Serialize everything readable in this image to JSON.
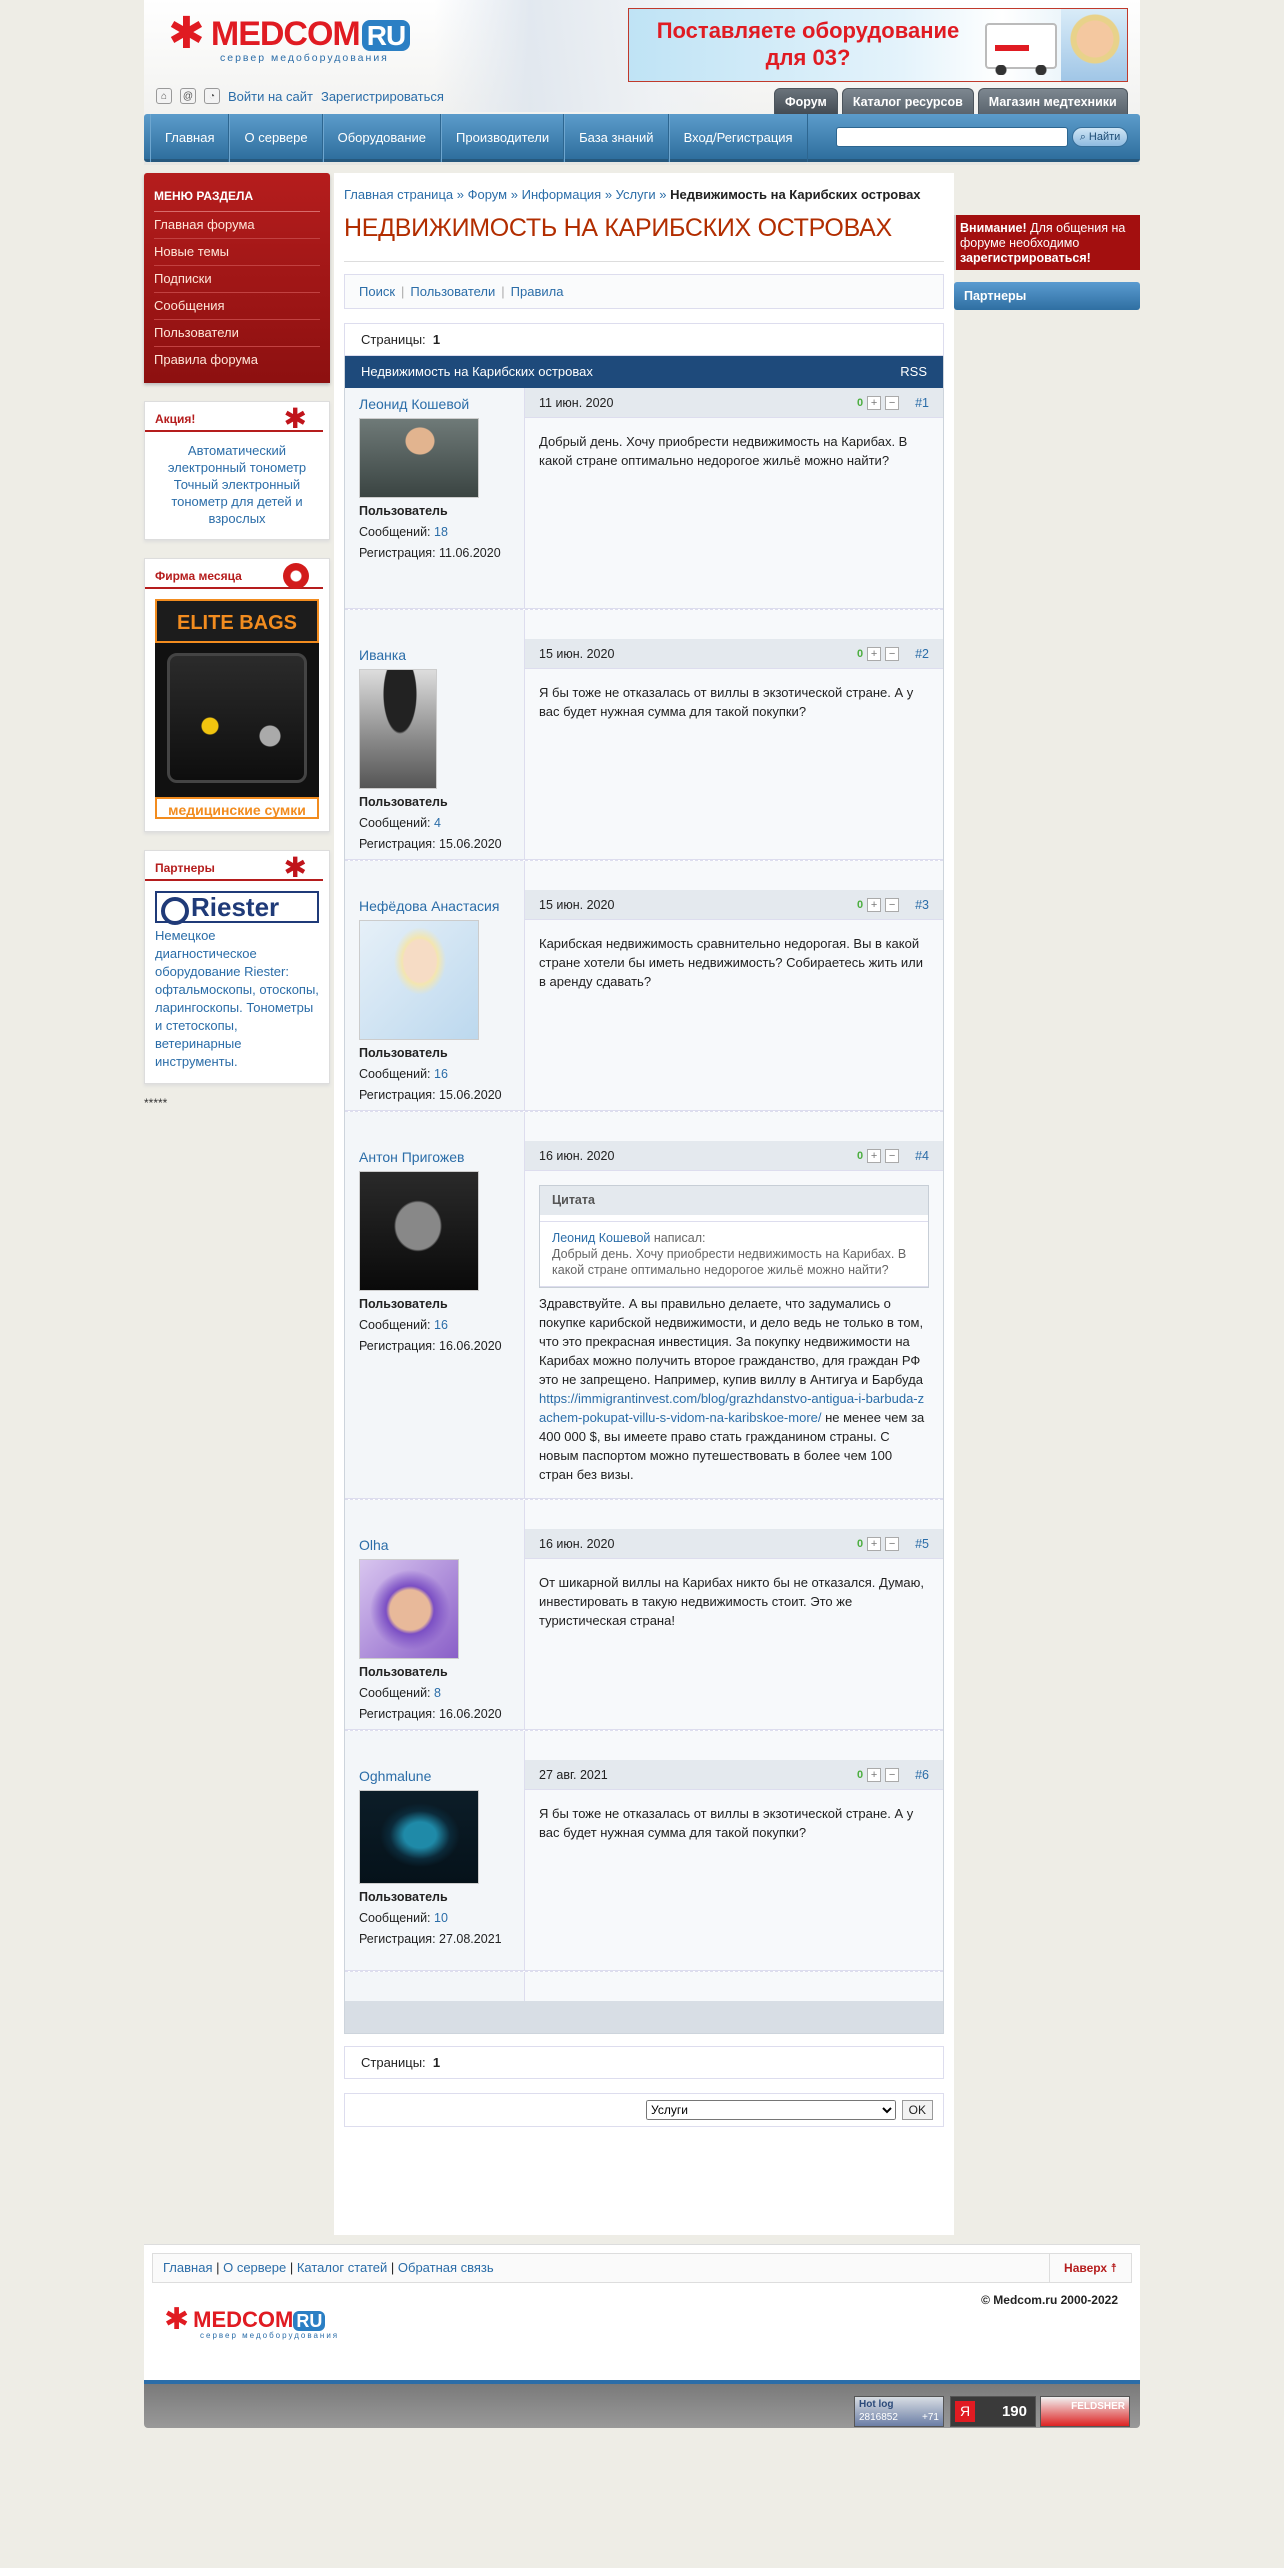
{
  "header": {
    "logo_name": "MEDCOM",
    "logo_ru": "RU",
    "logo_tagline": "сервер медоборудования",
    "login_link": "Войти на сайт",
    "register_link": "Зарегистрироваться",
    "banner_text": "Поставляете оборудование для 03?",
    "tabs": [
      "Форум",
      "Каталог ресурсов",
      "Магазин медтехники"
    ]
  },
  "nav": {
    "items": [
      "Главная",
      "О сервере",
      "Оборудование",
      "Производители",
      "База знаний",
      "Вход/Регистрация"
    ],
    "search_placeholder": "",
    "search_button": "Найти"
  },
  "sidebar": {
    "menu_title": "МЕНЮ РАЗДЕЛА",
    "menu_items": [
      "Главная форума",
      "Новые темы",
      "Подписки",
      "Сообщения",
      "Пользователи",
      "Правила форума"
    ],
    "promo_title": "Акция!",
    "promo_product": "Автоматический электронный тонометр Точный электронный тонометр для детей и взрослых",
    "firm_title": "Фирма месяца",
    "firm_banner_top": "ELITE BAGS",
    "firm_banner_bottom": "медицинские сумки",
    "partners_title": "Партнеры",
    "partner_logo": "Riester",
    "partner_text": "Немецкое диагностическое оборудование Riester: офтальмоскопы, отоскопы, ларингоскопы. Тонометры и стетоскопы, ветеринарные инструменты.",
    "stars": "*****"
  },
  "main": {
    "breadcrumb": [
      "Главная страница",
      "Форум",
      "Информация",
      "Услуги"
    ],
    "breadcrumb_sep": "»",
    "breadcrumb_current": "Недвижимость на Карибских островах",
    "title": "НЕДВИЖИМОСТЬ НА КАРИБСКИХ ОСТРОВАХ",
    "subnav": [
      "Поиск",
      "Пользователи",
      "Правила"
    ],
    "pages_label": "Страницы:",
    "pages_value": "1",
    "thread_title": "Недвижимость на Карибских островах",
    "rss": "RSS",
    "role_label": "Пользователь",
    "messages_label": "Сообщений:",
    "reg_label": "Регистрация:",
    "posts": [
      {
        "author": "Леонид Кошевой",
        "messages": "18",
        "registered": "11.06.2020",
        "date": "11 июн. 2020",
        "rating": "0",
        "num": "#1",
        "text": "Добрый день. Хочу приобрести недвижимость на Карибах. В какой стране оптимально недорогое жильё можно найти?"
      },
      {
        "author": "Иванка",
        "messages": "4",
        "registered": "15.06.2020",
        "date": "15 июн. 2020",
        "rating": "0",
        "num": "#2",
        "text": "Я бы тоже не отказалась от виллы в экзотической стране. А у вас будет нужная сумма для такой покупки?"
      },
      {
        "author": "Нефёдова Анастасия",
        "messages": "16",
        "registered": "15.06.2020",
        "date": "15 июн. 2020",
        "rating": "0",
        "num": "#3",
        "text": "Карибская недвижимость сравнительно недорогая. Вы в какой стране хотели бы иметь недвижимость? Собираетесь жить или в аренду сдавать?"
      },
      {
        "author": "Антон Пригожев",
        "messages": "16",
        "registered": "16.06.2020",
        "date": "16 июн. 2020",
        "rating": "0",
        "num": "#4",
        "quote_title": "Цитата",
        "quote_author": "Леонид Кошевой",
        "quote_wrote": "написал:",
        "quote_text": "Добрый день. Хочу приобрести недвижимость на Карибах. В какой стране оптимально недорогое жильё можно найти?",
        "text": "Здравствуйте. А вы правильно делаете, что задумались о покупке карибской недвижимости, и дело ведь не только в том, что это прекрасная инвестиция. За покупку недвижимости на Карибах можно получить второе гражданство, для граждан РФ это не запрещено. Например, купив виллу в Антигуа и Барбуда",
        "link": "https://immigrantinvest.com/blog/grazhdanstvo-antigua-i-barbuda-zachem-pokupat-villu-s-vidom-na-karibskoe-more/",
        "text_after": " не менее чем за 400 000 $, вы имеете право стать гражданином страны. С новым паспортом можно путешествовать в более чем 100 стран без визы."
      },
      {
        "author": "Olha",
        "messages": "8",
        "registered": "16.06.2020",
        "date": "16 июн. 2020",
        "rating": "0",
        "num": "#5",
        "text": "От шикарной виллы на Карибах никто бы не отказался. Думаю, инвестировать в такую недвижимость стоит. Это же туристическая страна!"
      },
      {
        "author": "Oghmalune",
        "messages": "10",
        "registered": "27.08.2021",
        "date": "27 авг. 2021",
        "rating": "0",
        "num": "#6",
        "text": "Я бы тоже не отказалась от виллы в экзотической стране. А у вас будет нужная сумма для такой покупки?"
      }
    ],
    "jump_select": "Услуги",
    "jump_ok": "OK"
  },
  "right": {
    "notice_strong": "Внимание!",
    "notice_text": "Для общения на форуме необходимо",
    "notice_link": "зарегистрироваться!",
    "partners_title": "Партнеры"
  },
  "footer": {
    "links": [
      "Главная",
      "О сервере",
      "Каталог статей",
      "Обратная связь"
    ],
    "up": "Наверх",
    "copyright": "© Medcom.ru 2000-2022",
    "counter2": "190",
    "counter1_top": "Hot log",
    "counter1_bottom": "2816852",
    "counter1_side": "+71",
    "counter3": "FELDSHER"
  }
}
